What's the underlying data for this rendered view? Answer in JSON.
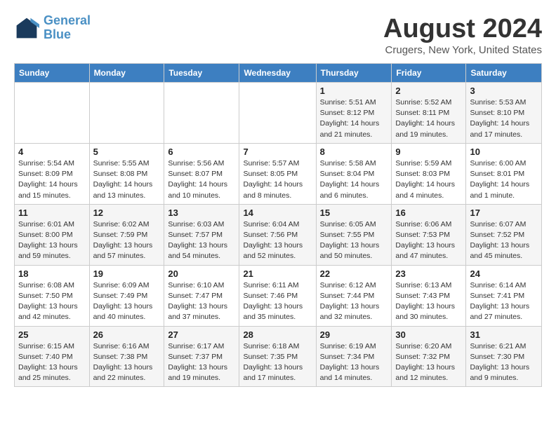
{
  "logo": {
    "line1": "General",
    "line2": "Blue"
  },
  "title": "August 2024",
  "location": "Crugers, New York, United States",
  "weekdays": [
    "Sunday",
    "Monday",
    "Tuesday",
    "Wednesday",
    "Thursday",
    "Friday",
    "Saturday"
  ],
  "weeks": [
    [
      {
        "day": "",
        "info": ""
      },
      {
        "day": "",
        "info": ""
      },
      {
        "day": "",
        "info": ""
      },
      {
        "day": "",
        "info": ""
      },
      {
        "day": "1",
        "info": "Sunrise: 5:51 AM\nSunset: 8:12 PM\nDaylight: 14 hours\nand 21 minutes."
      },
      {
        "day": "2",
        "info": "Sunrise: 5:52 AM\nSunset: 8:11 PM\nDaylight: 14 hours\nand 19 minutes."
      },
      {
        "day": "3",
        "info": "Sunrise: 5:53 AM\nSunset: 8:10 PM\nDaylight: 14 hours\nand 17 minutes."
      }
    ],
    [
      {
        "day": "4",
        "info": "Sunrise: 5:54 AM\nSunset: 8:09 PM\nDaylight: 14 hours\nand 15 minutes."
      },
      {
        "day": "5",
        "info": "Sunrise: 5:55 AM\nSunset: 8:08 PM\nDaylight: 14 hours\nand 13 minutes."
      },
      {
        "day": "6",
        "info": "Sunrise: 5:56 AM\nSunset: 8:07 PM\nDaylight: 14 hours\nand 10 minutes."
      },
      {
        "day": "7",
        "info": "Sunrise: 5:57 AM\nSunset: 8:05 PM\nDaylight: 14 hours\nand 8 minutes."
      },
      {
        "day": "8",
        "info": "Sunrise: 5:58 AM\nSunset: 8:04 PM\nDaylight: 14 hours\nand 6 minutes."
      },
      {
        "day": "9",
        "info": "Sunrise: 5:59 AM\nSunset: 8:03 PM\nDaylight: 14 hours\nand 4 minutes."
      },
      {
        "day": "10",
        "info": "Sunrise: 6:00 AM\nSunset: 8:01 PM\nDaylight: 14 hours\nand 1 minute."
      }
    ],
    [
      {
        "day": "11",
        "info": "Sunrise: 6:01 AM\nSunset: 8:00 PM\nDaylight: 13 hours\nand 59 minutes."
      },
      {
        "day": "12",
        "info": "Sunrise: 6:02 AM\nSunset: 7:59 PM\nDaylight: 13 hours\nand 57 minutes."
      },
      {
        "day": "13",
        "info": "Sunrise: 6:03 AM\nSunset: 7:57 PM\nDaylight: 13 hours\nand 54 minutes."
      },
      {
        "day": "14",
        "info": "Sunrise: 6:04 AM\nSunset: 7:56 PM\nDaylight: 13 hours\nand 52 minutes."
      },
      {
        "day": "15",
        "info": "Sunrise: 6:05 AM\nSunset: 7:55 PM\nDaylight: 13 hours\nand 50 minutes."
      },
      {
        "day": "16",
        "info": "Sunrise: 6:06 AM\nSunset: 7:53 PM\nDaylight: 13 hours\nand 47 minutes."
      },
      {
        "day": "17",
        "info": "Sunrise: 6:07 AM\nSunset: 7:52 PM\nDaylight: 13 hours\nand 45 minutes."
      }
    ],
    [
      {
        "day": "18",
        "info": "Sunrise: 6:08 AM\nSunset: 7:50 PM\nDaylight: 13 hours\nand 42 minutes."
      },
      {
        "day": "19",
        "info": "Sunrise: 6:09 AM\nSunset: 7:49 PM\nDaylight: 13 hours\nand 40 minutes."
      },
      {
        "day": "20",
        "info": "Sunrise: 6:10 AM\nSunset: 7:47 PM\nDaylight: 13 hours\nand 37 minutes."
      },
      {
        "day": "21",
        "info": "Sunrise: 6:11 AM\nSunset: 7:46 PM\nDaylight: 13 hours\nand 35 minutes."
      },
      {
        "day": "22",
        "info": "Sunrise: 6:12 AM\nSunset: 7:44 PM\nDaylight: 13 hours\nand 32 minutes."
      },
      {
        "day": "23",
        "info": "Sunrise: 6:13 AM\nSunset: 7:43 PM\nDaylight: 13 hours\nand 30 minutes."
      },
      {
        "day": "24",
        "info": "Sunrise: 6:14 AM\nSunset: 7:41 PM\nDaylight: 13 hours\nand 27 minutes."
      }
    ],
    [
      {
        "day": "25",
        "info": "Sunrise: 6:15 AM\nSunset: 7:40 PM\nDaylight: 13 hours\nand 25 minutes."
      },
      {
        "day": "26",
        "info": "Sunrise: 6:16 AM\nSunset: 7:38 PM\nDaylight: 13 hours\nand 22 minutes."
      },
      {
        "day": "27",
        "info": "Sunrise: 6:17 AM\nSunset: 7:37 PM\nDaylight: 13 hours\nand 19 minutes."
      },
      {
        "day": "28",
        "info": "Sunrise: 6:18 AM\nSunset: 7:35 PM\nDaylight: 13 hours\nand 17 minutes."
      },
      {
        "day": "29",
        "info": "Sunrise: 6:19 AM\nSunset: 7:34 PM\nDaylight: 13 hours\nand 14 minutes."
      },
      {
        "day": "30",
        "info": "Sunrise: 6:20 AM\nSunset: 7:32 PM\nDaylight: 13 hours\nand 12 minutes."
      },
      {
        "day": "31",
        "info": "Sunrise: 6:21 AM\nSunset: 7:30 PM\nDaylight: 13 hours\nand 9 minutes."
      }
    ]
  ]
}
